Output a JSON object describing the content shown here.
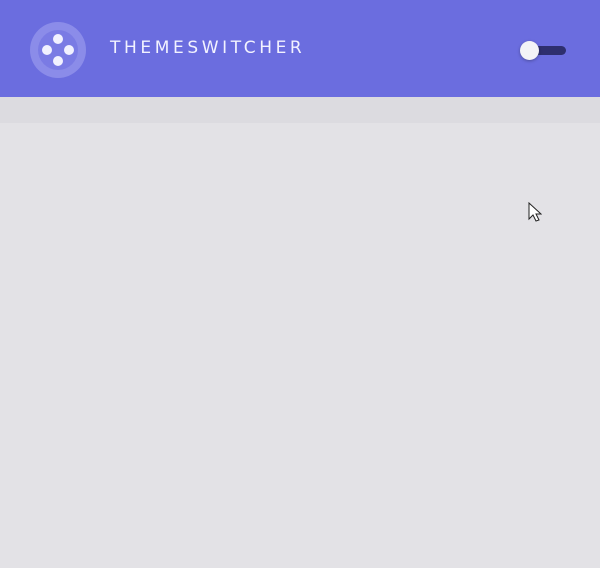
{
  "header": {
    "brand": "THEMESWITCHER",
    "logo_icon": "gamepad-icon",
    "background_color": "#6b6ddf",
    "toggle": {
      "icon": "toggle-switch-icon",
      "state": "off"
    }
  },
  "content": {
    "background_color": "#e3e2e6"
  }
}
